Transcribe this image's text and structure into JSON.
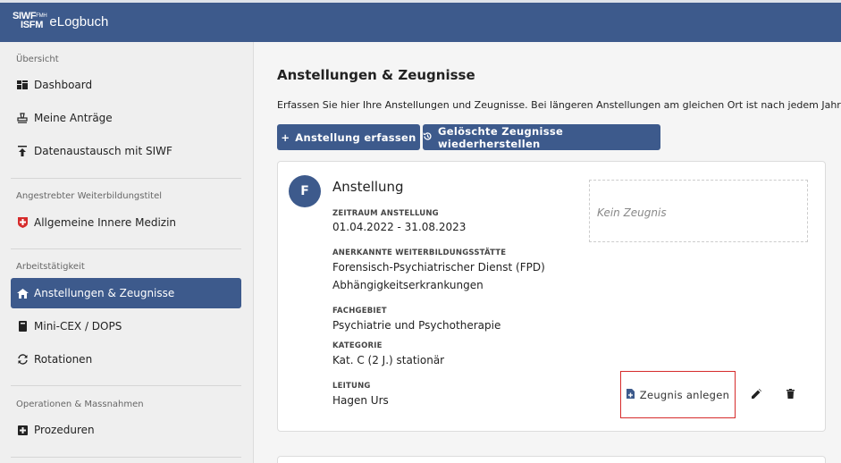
{
  "header": {
    "logo_top": "SIWF",
    "logo_tiny": "FMH",
    "logo_bottom": "ISFM",
    "app_name": "eLogbuch"
  },
  "sidebar": {
    "sections": [
      {
        "title": "Übersicht"
      },
      {
        "title": "Angestrebter Weiterbildungstitel"
      },
      {
        "title": "Arbeitstätigkeit"
      },
      {
        "title": "Operationen & Massnahmen"
      }
    ],
    "items": [
      {
        "label": "Dashboard",
        "icon": "dashboard-icon"
      },
      {
        "label": "Meine Anträge",
        "icon": "stamp-icon"
      },
      {
        "label": "Datenaustausch mit SIWF",
        "icon": "upload-icon"
      },
      {
        "label": "Allgemeine Innere Medizin",
        "icon": "swiss-cross-icon"
      },
      {
        "label": "Anstellungen & Zeugnisse",
        "icon": "house-icon",
        "active": true
      },
      {
        "label": "Mini-CEX / DOPS",
        "icon": "book-icon"
      },
      {
        "label": "Rotationen",
        "icon": "rotate-icon"
      },
      {
        "label": "Prozeduren",
        "icon": "plus-box-icon"
      }
    ]
  },
  "main": {
    "title": "Anstellungen & Zeugnisse",
    "description": "Erfassen Sie hier Ihre Anstellungen und Zeugnisse. Bei längeren Anstellungen am gleichen Ort ist nach jedem Jahr ein Zeugnis",
    "buttons": {
      "add_label": "Anstellung erfassen",
      "restore_label": "Gelöschte Zeugnisse wiederherstellen"
    },
    "card": {
      "avatar": "F",
      "title": "Anstellung",
      "period_label": "Zeitraum Anstellung",
      "period": "01.04.2022 - 31.08.2023",
      "site_label": "Anerkannte Weiterbildungsstätte",
      "site_line1": "Forensisch-Psychiatrischer Dienst (FPD)",
      "site_line2": "Abhängigkeitserkrankungen",
      "field_label": "Fachgebiet",
      "field": "Psychiatrie und Psychotherapie",
      "category_label": "Kategorie",
      "category": "Kat. C (2 J.) stationär",
      "lead_label": "Leitung",
      "lead": "Hagen Urs",
      "no_certificate": "Kein Zeugnis",
      "create_certificate_label": "Zeugnis anlegen"
    }
  },
  "colors": {
    "primary": "#3d5a8c",
    "highlight_border": "#d62b2b"
  }
}
